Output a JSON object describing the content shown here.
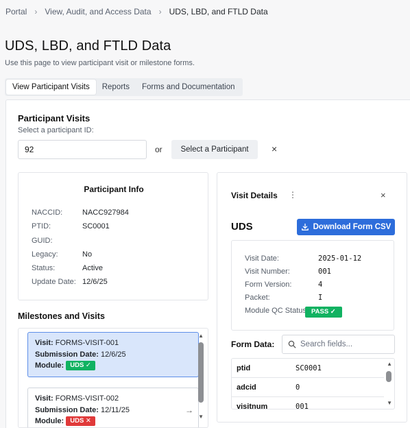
{
  "breadcrumb": {
    "items": [
      "Portal",
      "View, Audit, and Access Data",
      "UDS, LBD, and FTLD Data"
    ],
    "separator": "›"
  },
  "page": {
    "title": "UDS, LBD, and FTLD Data",
    "subtitle": "Use this page to view participant visit or milestone forms."
  },
  "tabs": [
    {
      "label": "View Participant Visits",
      "active": true
    },
    {
      "label": "Reports",
      "active": false
    },
    {
      "label": "Forms and Documentation",
      "active": false
    }
  ],
  "participant_visits": {
    "title": "Participant Visits",
    "prompt": "Select a participant ID:",
    "input_value": "92",
    "or_label": "or",
    "select_button": "Select a Participant",
    "clear_icon": "×"
  },
  "participant_info": {
    "title": "Participant Info",
    "rows": [
      {
        "label": "NACCID:",
        "value": "NACC927984"
      },
      {
        "label": "PTID:",
        "value": "SC0001"
      },
      {
        "label": "GUID:",
        "value": ""
      },
      {
        "label": "Legacy:",
        "value": "No"
      },
      {
        "label": "Status:",
        "value": "Active"
      },
      {
        "label": "Update Date:",
        "value": "12/6/25"
      }
    ]
  },
  "milestones": {
    "title": "Milestones and Visits",
    "visits": [
      {
        "visit_label": "Visit:",
        "visit": "FORMS-VISIT-001",
        "date_label": "Submission Date:",
        "date": "12/6/25",
        "module_label": "Module:",
        "module": "UDS ✓",
        "status": "pass",
        "selected": true
      },
      {
        "visit_label": "Visit:",
        "visit": "FORMS-VISIT-002",
        "date_label": "Submission Date:",
        "date": "12/11/25",
        "module_label": "Module:",
        "module": "UDS ✕",
        "status": "fail",
        "selected": false
      }
    ]
  },
  "visit_details": {
    "title": "Visit Details",
    "kebab_icon": "⋮",
    "close_icon": "×",
    "module": "UDS",
    "download_button": "Download Form CSV",
    "info": [
      {
        "label": "Visit Date:",
        "value": "2025-01-12"
      },
      {
        "label": "Visit Number:",
        "value": "001"
      },
      {
        "label": "Form Version:",
        "value": "4"
      },
      {
        "label": "Packet:",
        "value": "I"
      },
      {
        "label": "Module QC Status:",
        "value": "PASS ✓"
      }
    ],
    "form_data_label": "Form Data:",
    "search_placeholder": "Search fields...",
    "form_rows": [
      {
        "key": "ptid",
        "value": "SC0001"
      },
      {
        "key": "adcid",
        "value": "0"
      },
      {
        "key": "visitnum",
        "value": "001"
      }
    ]
  },
  "colors": {
    "accent": "#2d6ddb",
    "pass": "#10b261",
    "fail": "#e03a3a",
    "selected_bg": "#d9e6fb"
  },
  "icons": {
    "download": "download-icon",
    "search": "search-icon",
    "arrow": "arrow-right-icon"
  }
}
